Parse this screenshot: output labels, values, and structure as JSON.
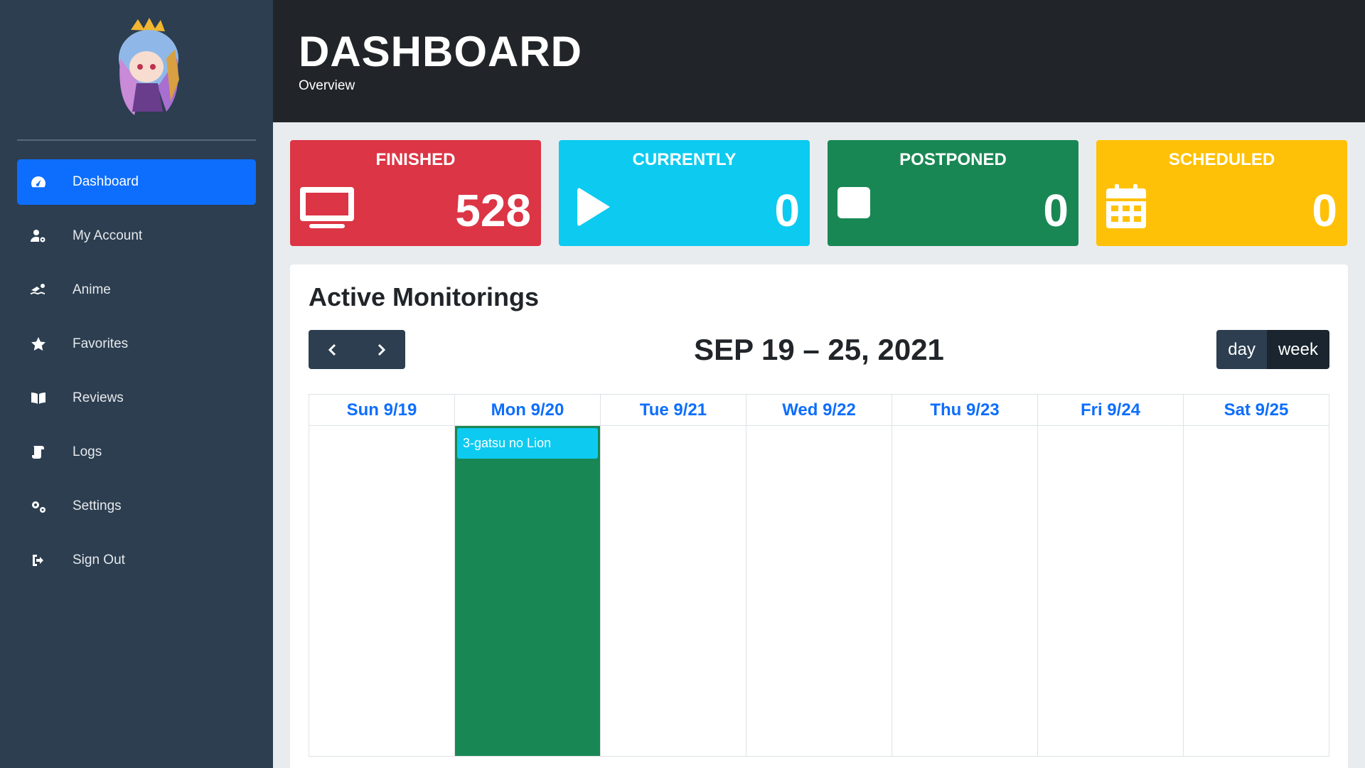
{
  "sidebar": {
    "items": [
      {
        "label": "Dashboard",
        "icon": "tachometer-icon"
      },
      {
        "label": "My Account",
        "icon": "user-cog-icon"
      },
      {
        "label": "Anime",
        "icon": "swimmer-icon"
      },
      {
        "label": "Favorites",
        "icon": "star-icon"
      },
      {
        "label": "Reviews",
        "icon": "book-open-icon"
      },
      {
        "label": "Logs",
        "icon": "scroll-icon"
      },
      {
        "label": "Settings",
        "icon": "cogs-icon"
      },
      {
        "label": "Sign Out",
        "icon": "sign-out-icon"
      }
    ],
    "active_item": "Dashboard"
  },
  "header": {
    "title": "DASHBOARD",
    "subtitle": "Overview"
  },
  "stats": [
    {
      "label": "FINISHED",
      "value": "528",
      "icon": "tv-icon",
      "color": "#dc3545"
    },
    {
      "label": "CURRENTLY",
      "value": "0",
      "icon": "play-icon",
      "color": "#0dcaf0"
    },
    {
      "label": "POSTPONED",
      "value": "0",
      "icon": "stop-icon",
      "color": "#198754"
    },
    {
      "label": "SCHEDULED",
      "value": "0",
      "icon": "calendar-icon",
      "color": "#ffc107"
    }
  ],
  "monitorings": {
    "title": "Active Monitorings",
    "range": "SEP 19 – 25, 2021",
    "views": [
      "day",
      "week"
    ],
    "active_view": "week",
    "days": [
      "Sun 9/19",
      "Mon 9/20",
      "Tue 9/21",
      "Wed 9/22",
      "Thu 9/23",
      "Fri 9/24",
      "Sat 9/25"
    ],
    "events": [
      {
        "day": "Mon 9/20",
        "title": "3-gatsu no Lion"
      }
    ]
  },
  "colors": {
    "sidebar_bg": "#2c3e50",
    "header_bg": "#212529",
    "accent": "#0d6efd",
    "event_column": "#198754",
    "event_chip": "#0dcaf0"
  }
}
